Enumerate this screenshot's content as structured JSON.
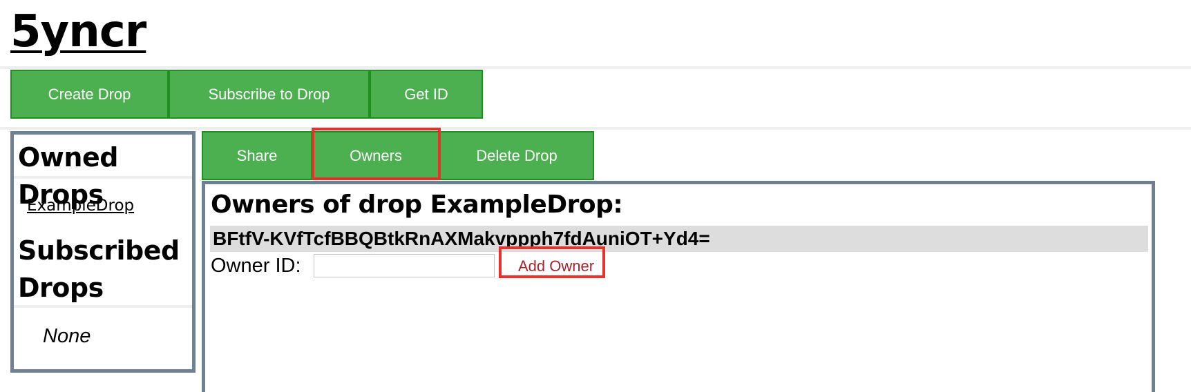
{
  "app": {
    "title": "5yncr"
  },
  "toolbar": {
    "create_drop": "Create Drop",
    "subscribe_to_drop": "Subscribe to Drop",
    "get_id": "Get ID"
  },
  "sidebar": {
    "owned_heading": "Owned Drops",
    "owned_items": [
      "ExampleDrop"
    ],
    "subscribed_heading_line1": "Subscribed",
    "subscribed_heading_line2": "Drops",
    "subscribed_empty": "None"
  },
  "drop_tabs": {
    "share": "Share",
    "owners": "Owners",
    "delete_drop": "Delete Drop",
    "active": "Owners"
  },
  "owners_panel": {
    "heading": "Owners of drop ExampleDrop:",
    "owners": [
      "BFtfV-KVfTcfBBQBtkRnAXMakvppph7fdAuniOT+Yd4="
    ],
    "owner_id_label": "Owner ID:",
    "owner_id_value": "",
    "add_owner_button": "Add Owner"
  },
  "colors": {
    "button_green": "#4caf50",
    "button_border": "#1f8f1f",
    "panel_border": "#6e8092",
    "highlight_red": "#e8312a",
    "add_owner_text": "#a4262c",
    "owner_row_bg": "#dddddd"
  }
}
